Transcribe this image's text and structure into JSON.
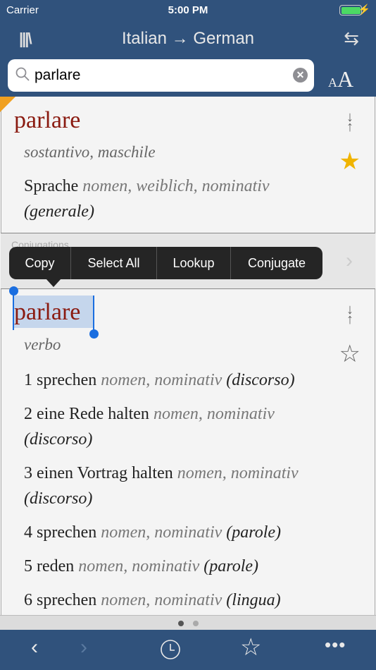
{
  "status": {
    "carrier": "Carrier",
    "time": "5:00 PM",
    "battery_level": 1.0
  },
  "nav": {
    "title": "Italian → German",
    "library_icon": "library-icon",
    "swap_icon": "swap-icon"
  },
  "search": {
    "value": "parlare",
    "placeholder": ""
  },
  "font_size": {
    "small": "A",
    "big": "A"
  },
  "entry1": {
    "headword": "parlare",
    "pos": "sostantivo, maschile",
    "translation": "Sprache",
    "grammar": "nomen, weiblich, nominativ",
    "context": "(generale)",
    "favorite": true
  },
  "conjugations": {
    "label": "Conjugations"
  },
  "context_menu": [
    "Copy",
    "Select All",
    "Lookup",
    "Conjugate"
  ],
  "entry2": {
    "headword": "parlare",
    "pos": "verbo",
    "favorite": false,
    "senses": [
      {
        "n": "1",
        "t": "sprechen",
        "g": "nomen, nominativ",
        "c": "(discorso)"
      },
      {
        "n": "2",
        "t": "eine Rede halten",
        "g": "nomen, nominativ",
        "c": "(discorso)"
      },
      {
        "n": "3",
        "t": "einen Vortrag halten",
        "g": "nomen, nominativ",
        "c": "(discorso)"
      },
      {
        "n": "4",
        "t": "sprechen",
        "g": "nomen, nominativ",
        "c": "(parole)"
      },
      {
        "n": "5",
        "t": "reden",
        "g": "nomen, nominativ",
        "c": "(parole)"
      },
      {
        "n": "6",
        "t": "sprechen",
        "g": "nomen, nominativ",
        "c": "(lingua)"
      }
    ]
  },
  "page_indicator": {
    "pages": 2,
    "current": 1
  },
  "colors": {
    "bar": "#30527c",
    "headword": "#8a1a10",
    "selection": "#1a6ee0",
    "star": "#f0b400"
  }
}
